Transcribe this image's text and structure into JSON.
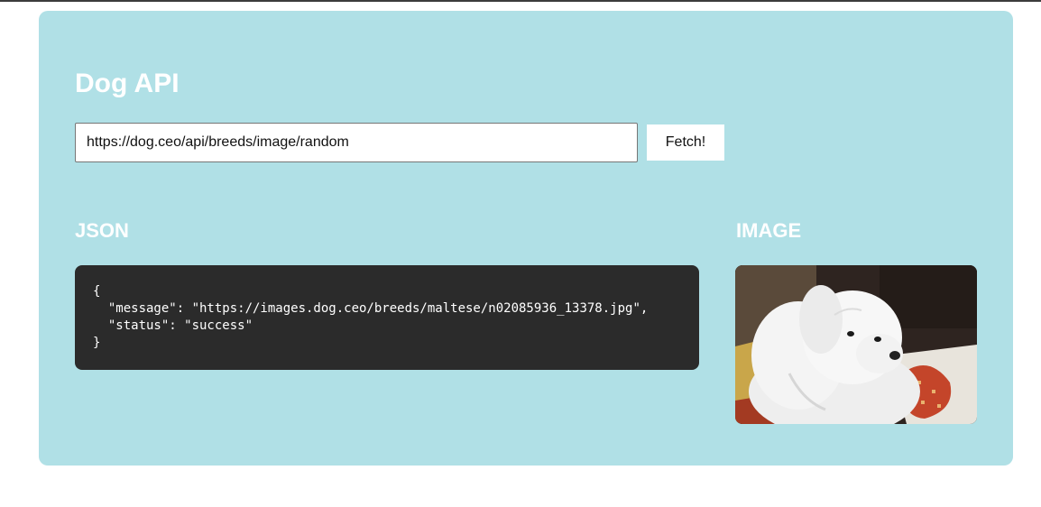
{
  "app": {
    "title": "Dog API"
  },
  "request": {
    "url_value": "https://dog.ceo/api/breeds/image/random",
    "fetch_label": "Fetch!"
  },
  "sections": {
    "json_heading": "JSON",
    "image_heading": "IMAGE"
  },
  "response": {
    "json_text": "{\n  \"message\": \"https://images.dog.ceo/breeds/maltese/n02085936_13378.jpg\",\n  \"status\": \"success\"\n}"
  },
  "colors": {
    "card_background": "#b0e0e6",
    "code_background": "#2b2b2b",
    "text_on_card": "#ffffff"
  },
  "image": {
    "subject": "white maltese dog photo"
  }
}
